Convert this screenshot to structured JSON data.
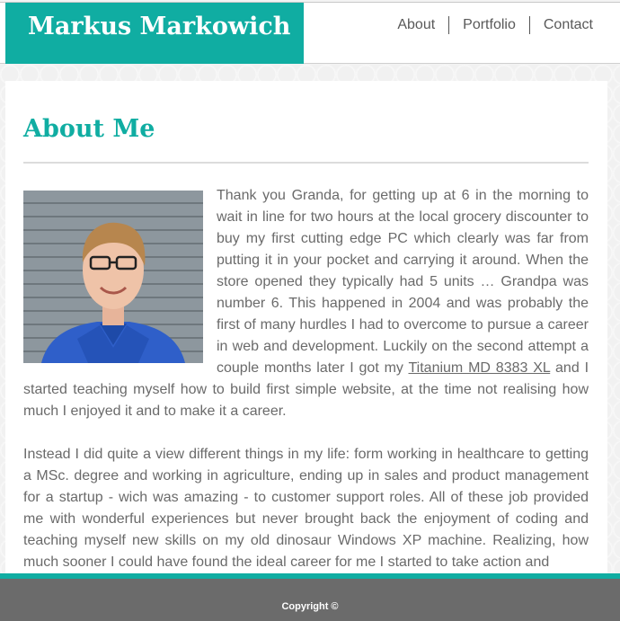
{
  "site": {
    "brand": "Markus Markowich"
  },
  "nav": {
    "items": [
      {
        "label": "About"
      },
      {
        "label": "Portfolio"
      },
      {
        "label": "Contact"
      }
    ]
  },
  "main": {
    "heading": "About Me",
    "paragraph1_before_link": "Thank you Granda, for getting up at 6 in the morning to wait in line for two hours at the local grocery discounter to buy my first cutting edge PC which clearly was far from putting it in your pocket and carrying it around. When the store opened they typically had 5 units … Grandpa was number 6. This happened in 2004 and was probably the first of many hurdles I had to overcome to pursue a career in web and development. Luckily on the second attempt a couple months later I got my ",
    "paragraph1_link": "Titanium MD 8383 XL",
    "paragraph1_after_link": " and I started teaching myself how to build first simple website, at the time not realising how much I enjoyed it and to make it a career.",
    "paragraph2": "Instead I did quite a view different things in my life: form working in healthcare to getting a MSc. degree and working in agriculture, ending up in sales and product management for a startup - wich was amazing - to customer support roles. All of these job provided me with wonderful experiences but never brought back the enjoyment of coding and teaching myself new skills on my old dinosaur Windows XP machine. Realizing, how much sooner I could have found the ideal career for me I started to take action and"
  },
  "footer": {
    "copyright": "Copyright ©"
  },
  "colors": {
    "accent": "#10ada2",
    "footer": "#6b6b6b"
  }
}
